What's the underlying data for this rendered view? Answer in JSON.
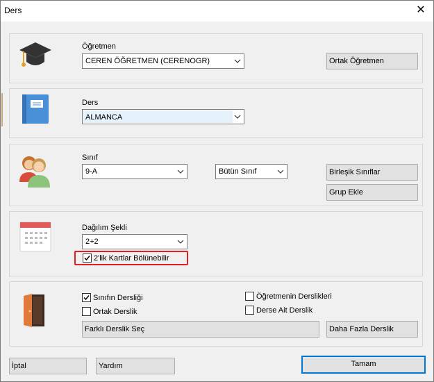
{
  "window": {
    "title": "Ders",
    "close_glyph": "✕"
  },
  "teacher": {
    "label": "Öğretmen",
    "value": "CEREN ÖĞRETMEN (CERENOGR)",
    "button": "Ortak Öğretmen",
    "icon": "graduation-cap-icon"
  },
  "subject": {
    "label": "Ders",
    "value": "ALMANCA",
    "icon": "book-icon"
  },
  "class": {
    "label": "Sınıf",
    "value": "9-A",
    "scope_value": "Bütün Sınıf",
    "merge_button": "Birleşik Sınıflar",
    "group_button": "Grup Ekle",
    "icon": "students-icon"
  },
  "distribution": {
    "label": "Dağılım Şekli",
    "value": "2+2",
    "split_label": "2'lik Kartlar Bölünebilir",
    "split_checked": true,
    "icon": "calendar-icon"
  },
  "classroom": {
    "icon": "door-icon",
    "class_rooms": {
      "label": "Sınıfın Dersliği",
      "checked": true
    },
    "shared_rooms": {
      "label": "Ortak Derslik",
      "checked": false
    },
    "teacher_rooms": {
      "label": "Öğretmenin Derslikleri",
      "checked": false
    },
    "subject_rooms": {
      "label": "Derse Ait Derslik",
      "checked": false
    },
    "select_button": "Farklı Derslik Seç",
    "more_button": "Daha Fazla Derslik"
  },
  "footer": {
    "cancel": "İptal",
    "help": "Yardım",
    "ok": "Tamam"
  },
  "colors": {
    "highlight": "#e02020",
    "accent": "#0078d7"
  }
}
